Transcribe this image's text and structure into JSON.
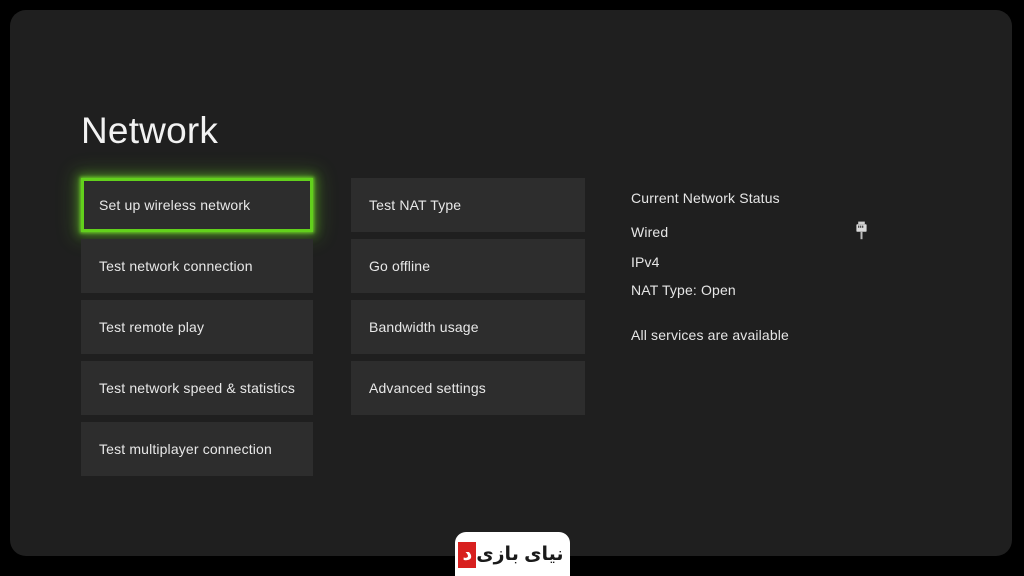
{
  "screen": {
    "title": "Network",
    "background_color": "#1f1f1f",
    "accent_color": "#62d01c",
    "tile_color": "#2d2d2d"
  },
  "left_column": {
    "items": [
      {
        "label": "Set up wireless network",
        "selected": true
      },
      {
        "label": "Test network connection",
        "selected": false
      },
      {
        "label": "Test remote play",
        "selected": false
      },
      {
        "label": "Test network speed & statistics",
        "selected": false
      },
      {
        "label": "Test multiplayer connection",
        "selected": false
      }
    ]
  },
  "middle_column": {
    "items": [
      {
        "label": "Test NAT Type",
        "selected": false
      },
      {
        "label": "Go offline",
        "selected": false
      },
      {
        "label": "Bandwidth usage",
        "selected": false
      },
      {
        "label": "Advanced settings",
        "selected": false
      }
    ]
  },
  "status_panel": {
    "heading": "Current Network Status",
    "connection_type": "Wired",
    "connection_icon": "ethernet-plug-icon",
    "ip_version": "IPv4",
    "nat_type": "NAT Type: Open",
    "services": "All services are available"
  },
  "watermark": {
    "text": "نیای بازی",
    "badge": "د",
    "badge_color": "#d8201f"
  }
}
